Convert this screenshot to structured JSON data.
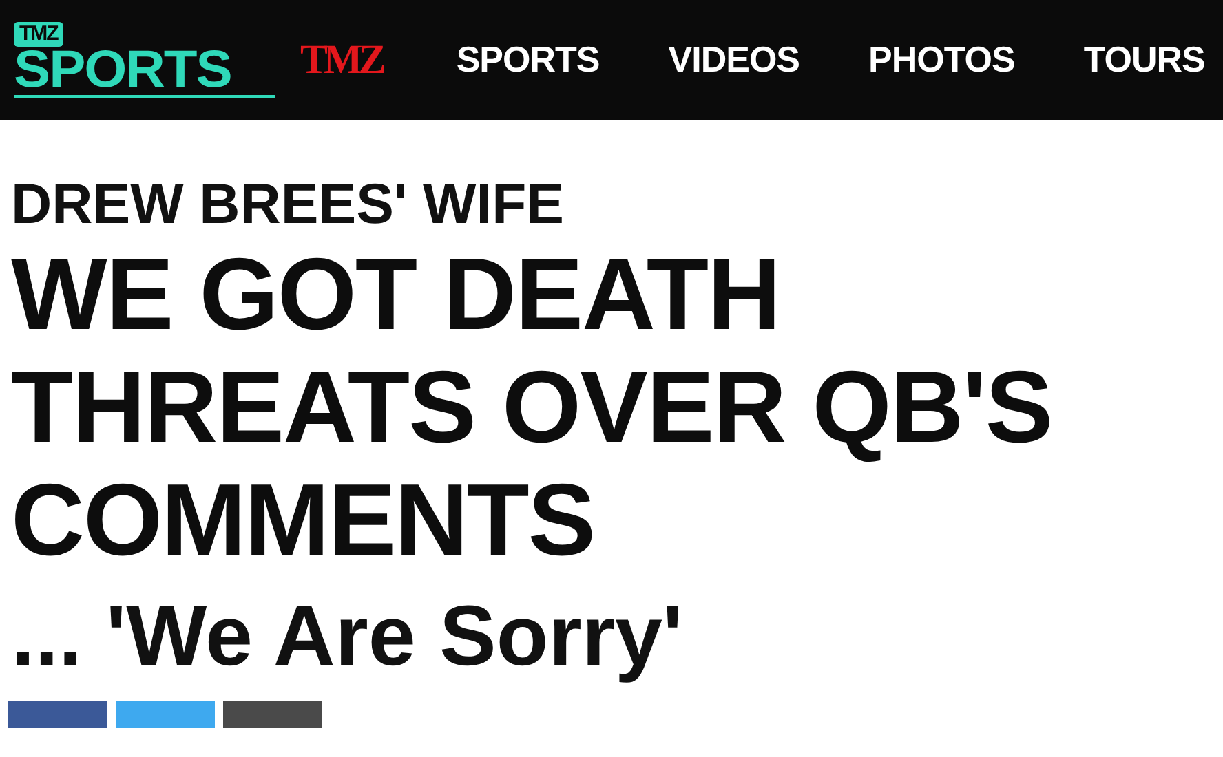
{
  "logo": {
    "badge": "TMZ",
    "name": "SPORTS"
  },
  "nav": [
    {
      "label": "TMZ",
      "kind": "brand"
    },
    {
      "label": "SPORTS",
      "kind": "link"
    },
    {
      "label": "VIDEOS",
      "kind": "link"
    },
    {
      "label": "PHOTOS",
      "kind": "link"
    },
    {
      "label": "TOURS",
      "kind": "link"
    }
  ],
  "article": {
    "kicker": "DREW BREES' WIFE",
    "headline": "WE GOT DEATH THREATS OVER QB'S COMMENTS",
    "subhead": "... 'We Are Sorry'"
  },
  "share_buttons": [
    {
      "color": "#3b5998"
    },
    {
      "color": "#3ea9ef"
    },
    {
      "color": "#4a4a4a"
    }
  ]
}
